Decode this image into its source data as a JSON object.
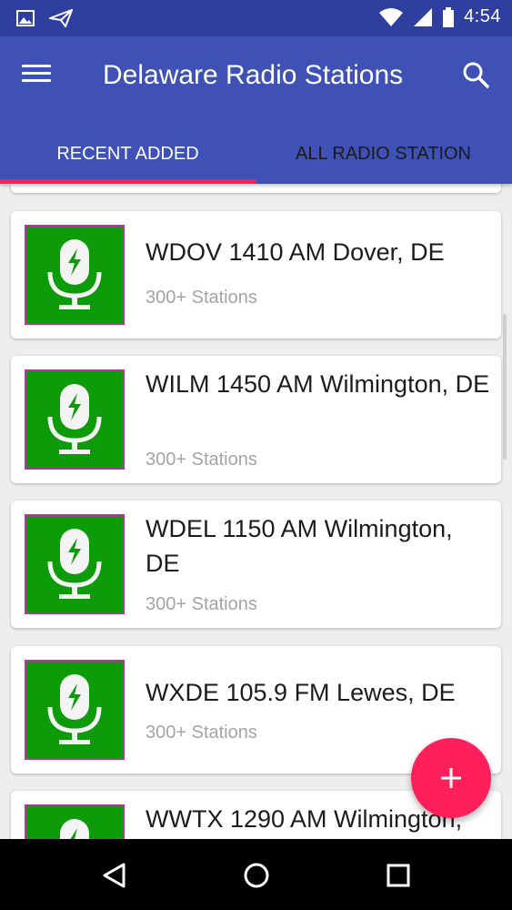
{
  "status_bar": {
    "time": "4:54",
    "icons": [
      "image-icon",
      "send-icon",
      "wifi-icon",
      "signal-icon",
      "battery-icon"
    ]
  },
  "app_bar": {
    "title": "Delaware Radio Stations",
    "menu_icon": "menu-icon",
    "search_icon": "search-icon"
  },
  "tabs": [
    {
      "label": "RECENT ADDED",
      "active": true
    },
    {
      "label": "ALL RADIO STATION",
      "active": false
    }
  ],
  "stations": [
    {
      "name": "WDOV 1410 AM Dover, DE",
      "subtitle": "300+ Stations"
    },
    {
      "name": "WILM 1450 AM Wilmington, DE",
      "subtitle": "300+ Stations"
    },
    {
      "name": "WDEL 1150 AM Wilmington, DE",
      "subtitle": "300+ Stations"
    },
    {
      "name": "WXDE 105.9 FM Lewes, DE",
      "subtitle": "300+ Stations"
    },
    {
      "name": "WWTX 1290 AM Wilmington,",
      "subtitle": ""
    }
  ],
  "fab": {
    "icon": "plus-icon"
  },
  "nav_bar": {
    "icons": [
      "back-icon",
      "home-icon",
      "recents-icon"
    ]
  },
  "colors": {
    "primary": "#3f51b5",
    "status_bar": "#2f3f9f",
    "accent": "#ff1f5a",
    "thumb_green": "#0d9b09",
    "thumb_border": "#b3379b"
  }
}
